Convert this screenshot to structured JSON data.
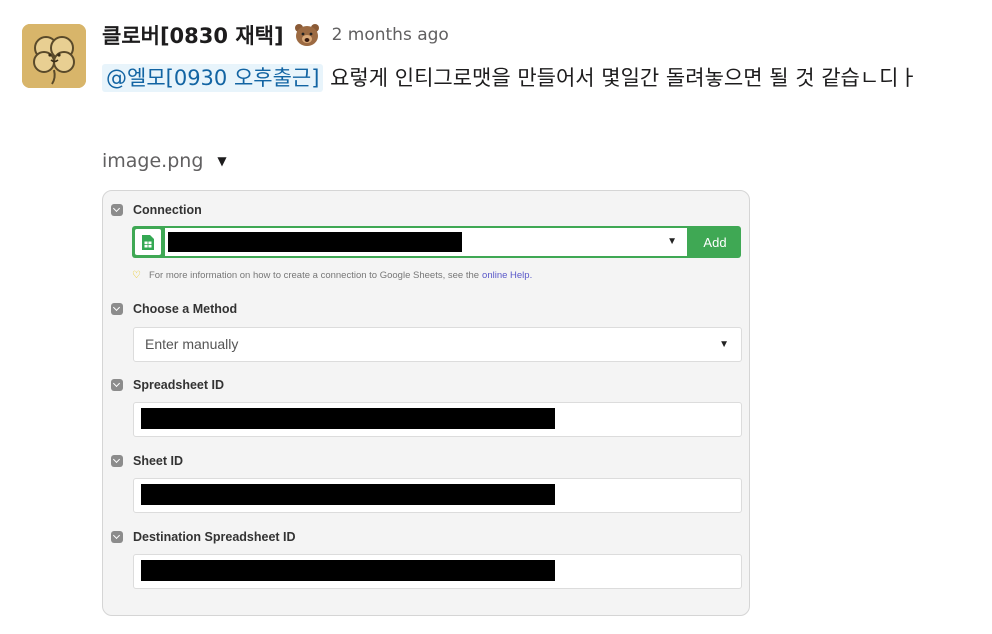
{
  "message": {
    "author": "클로버[0830 재택]",
    "status_emoji": "bear-face-icon",
    "timestamp": "2 months ago",
    "mention": "@엘모[0930 오후출근]",
    "text": " 요렇게 인티그로맷을 만들어서 몇일간 돌려놓으면 될 것 같습ㄴ디ㅏ"
  },
  "attachment": {
    "file_name": "image.png",
    "caret_icon": "caret-down-icon"
  },
  "screenshot": {
    "connection": {
      "label": "Connection",
      "add_label": "Add",
      "icon": "google-sheets-icon",
      "hint_text": "For more information on how to create a connection to Google Sheets, see the",
      "hint_link": "online Help."
    },
    "method": {
      "label": "Choose a Method",
      "value": "Enter manually"
    },
    "spreadsheet_id": {
      "label": "Spreadsheet ID"
    },
    "sheet_id": {
      "label": "Sheet ID"
    },
    "destination_spreadsheet_id": {
      "label": "Destination Spreadsheet ID"
    },
    "colors": {
      "accent_green": "#3fa854",
      "link_purple": "#5a58c9",
      "mention_blue": "#1264a3"
    }
  }
}
